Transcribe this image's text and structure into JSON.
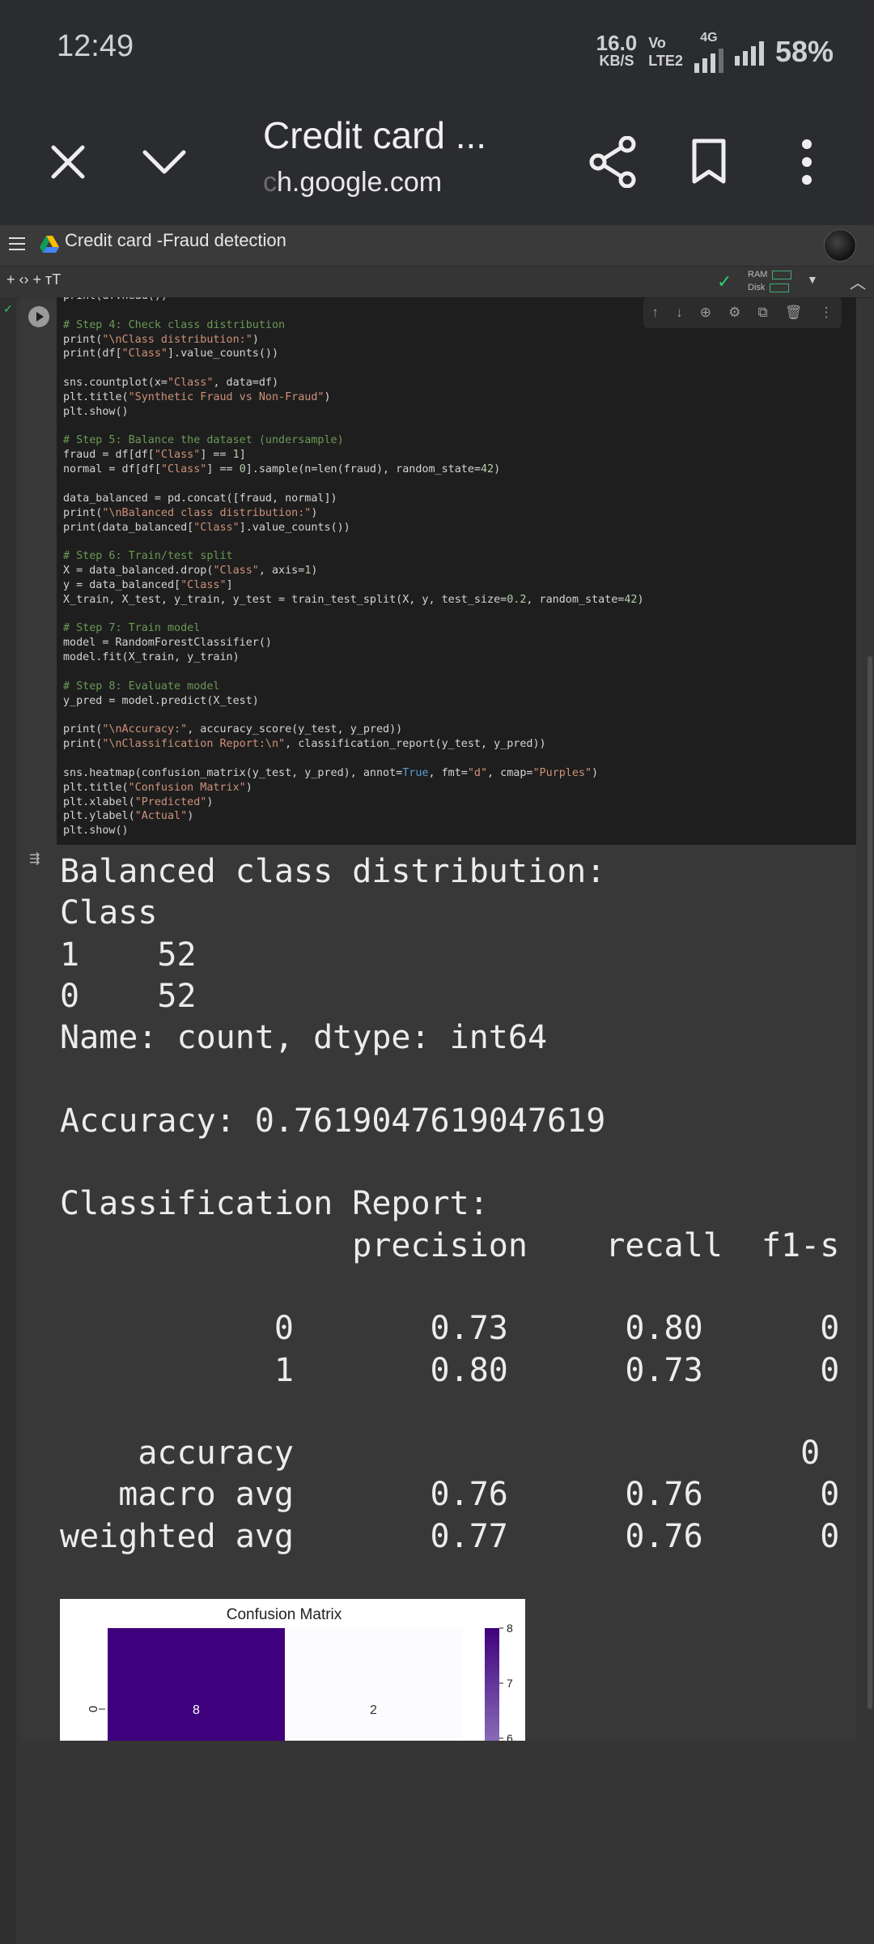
{
  "status_bar": {
    "time": "12:49",
    "net_speed": "16.0",
    "net_unit": "KB/S",
    "volte_top": "Vo ",
    "volte_bottom": "LTE2",
    "network": "4G",
    "battery": "58%"
  },
  "browser": {
    "page_title": "Credit card ...",
    "url_faded": "c",
    "url": "h.google.com",
    "close_icon": "close-icon",
    "dropdown_icon": "chevron-down-icon",
    "share_icon": "share-icon",
    "bookmark_icon": "bookmark-icon",
    "menu_icon": "more-vert-icon"
  },
  "colab": {
    "notebook_title": "Credit card -Fraud detection",
    "toolbar_left": "+ ‹›  + ᴛT",
    "ram_label": "RAM",
    "disk_label": "Disk"
  },
  "cell_tools": [
    "↑",
    "↓",
    "⊕",
    "⚙",
    "⧉",
    "🗑",
    "⋮"
  ],
  "code_lines": [
    "print(df.head())",
    "",
    "# Step 4: Check class distribution",
    "print(\"\\nClass distribution:\")",
    "print(df[\"Class\"].value_counts())",
    "",
    "sns.countplot(x=\"Class\", data=df)",
    "plt.title(\"Synthetic Fraud vs Non-Fraud\")",
    "plt.show()",
    "",
    "# Step 5: Balance the dataset (undersample)",
    "fraud = df[df[\"Class\"] == 1]",
    "normal = df[df[\"Class\"] == 0].sample(n=len(fraud), random_state=42)",
    "",
    "data_balanced = pd.concat([fraud, normal])",
    "print(\"\\nBalanced class distribution:\")",
    "print(data_balanced[\"Class\"].value_counts())",
    "",
    "# Step 6: Train/test split",
    "X = data_balanced.drop(\"Class\", axis=1)",
    "y = data_balanced[\"Class\"]",
    "X_train, X_test, y_train, y_test = train_test_split(X, y, test_size=0.2, random_state=42)",
    "",
    "# Step 7: Train model",
    "model = RandomForestClassifier()",
    "model.fit(X_train, y_train)",
    "",
    "# Step 8: Evaluate model",
    "y_pred = model.predict(X_test)",
    "",
    "print(\"\\nAccuracy:\", accuracy_score(y_test, y_pred))",
    "print(\"\\nClassification Report:\\n\", classification_report(y_test, y_pred))",
    "",
    "sns.heatmap(confusion_matrix(y_test, y_pred), annot=True, fmt=\"d\", cmap=\"Purples\")",
    "plt.title(\"Confusion Matrix\")",
    "plt.xlabel(\"Predicted\")",
    "plt.ylabel(\"Actual\")",
    "plt.show()"
  ],
  "output_lines": [
    "Balanced class distribution:",
    "Class",
    "1    52",
    "0    52",
    "Name: count, dtype: int64",
    "",
    "Accuracy: 0.7619047619047619",
    "",
    "Classification Report:",
    "               precision    recall  f1-s",
    "",
    "           0       0.73      0.80      0",
    "           1       0.80      0.73      0",
    "",
    "    accuracy                          0",
    "   macro avg       0.76      0.76      0",
    "weighted avg       0.77      0.76      0"
  ],
  "chart_data": {
    "type": "heatmap",
    "title": "Confusion Matrix",
    "ylabel_tick": "0",
    "row_labels": [
      "0"
    ],
    "values": [
      [
        8,
        2
      ]
    ],
    "colorbar_ticks": [
      8,
      7,
      6
    ],
    "colors": {
      "high": "#3f007d",
      "low": "#fcfbfd"
    }
  }
}
